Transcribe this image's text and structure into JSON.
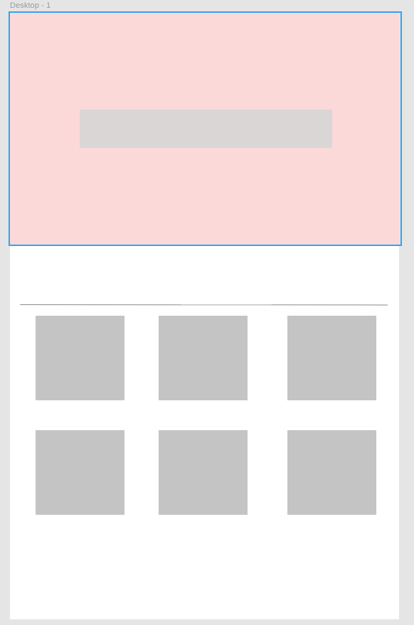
{
  "canvas": {
    "frame_label": "Desktop - 1",
    "background_color": "#e5e5e5"
  },
  "frame": {
    "background_color": "#ffffff",
    "hero": {
      "background_color": "#fcd9d9",
      "bar_color": "#dbd6d6",
      "selected": true,
      "selection_color": "#30a4f3"
    },
    "divider_color": "#8a8a8a",
    "tiles": {
      "count": 6,
      "color": "#c4c4c4"
    }
  }
}
